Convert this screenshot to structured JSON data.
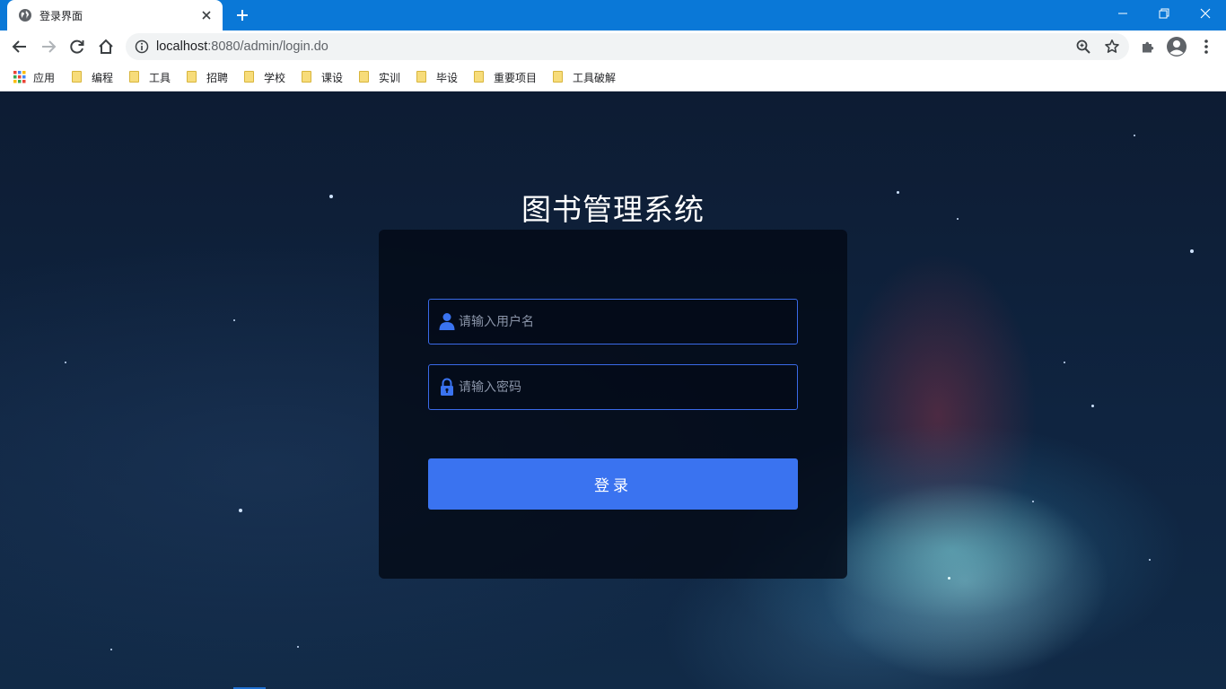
{
  "browser": {
    "tab_title": "登录界面",
    "address": {
      "host": "localhost",
      "rest": ":8080/admin/login.do"
    },
    "icons": {
      "favicon": "globe-icon",
      "close": "close-icon",
      "new_tab": "plus-icon",
      "back": "back-arrow-icon",
      "forward": "forward-arrow-icon",
      "reload": "reload-icon",
      "home": "home-icon",
      "site_info": "info-icon",
      "zoom": "zoom-icon",
      "bookmark": "star-icon",
      "extensions": "puzzle-icon",
      "profile": "avatar-icon",
      "menu": "kebab-menu-icon"
    },
    "accent_color": "#0a78d7"
  },
  "bookmarks": {
    "apps_label": "应用",
    "items": [
      "编程",
      "工具",
      "招聘",
      "学校",
      "课设",
      "实训",
      "毕设",
      "重要项目",
      "工具破解"
    ]
  },
  "login": {
    "title": "图书管理系统",
    "username_placeholder": "请输入用户名",
    "password_placeholder": "请输入密码",
    "submit_label": "登录",
    "accent_color": "#3a73f0"
  }
}
